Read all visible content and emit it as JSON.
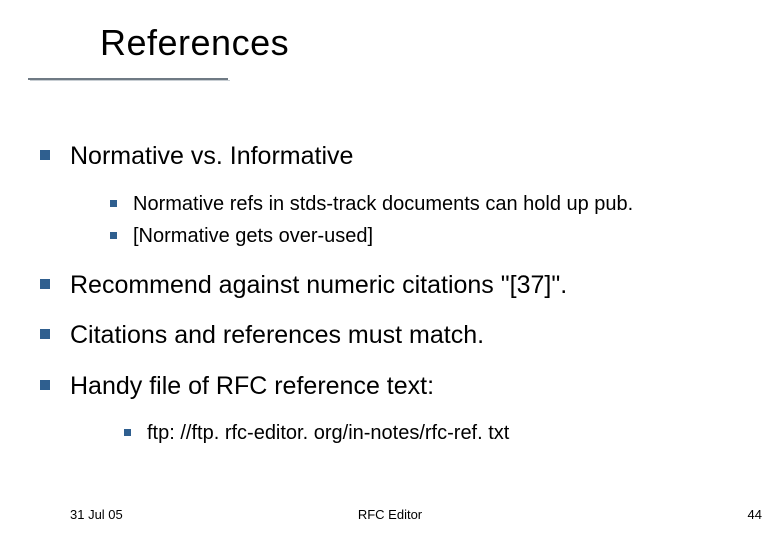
{
  "title": "References",
  "bullets": {
    "b1": {
      "text": "Normative vs. Informative",
      "sub": {
        "s1": "Normative refs in stds-track documents can hold up pub.",
        "s2": "[Normative gets over-used]"
      }
    },
    "b2": {
      "text": "Recommend against numeric citations \"[37]\"."
    },
    "b3": {
      "text": "Citations and references must match."
    },
    "b4": {
      "text": "Handy file of RFC reference text:",
      "sub": {
        "s1": "ftp: //ftp. rfc-editor. org/in-notes/rfc-ref. txt"
      }
    }
  },
  "footer": {
    "date": "31 Jul 05",
    "center": "RFC Editor",
    "page": "44"
  },
  "colors": {
    "bullet": "#2f5f8f",
    "underline": "#6f7a84"
  }
}
